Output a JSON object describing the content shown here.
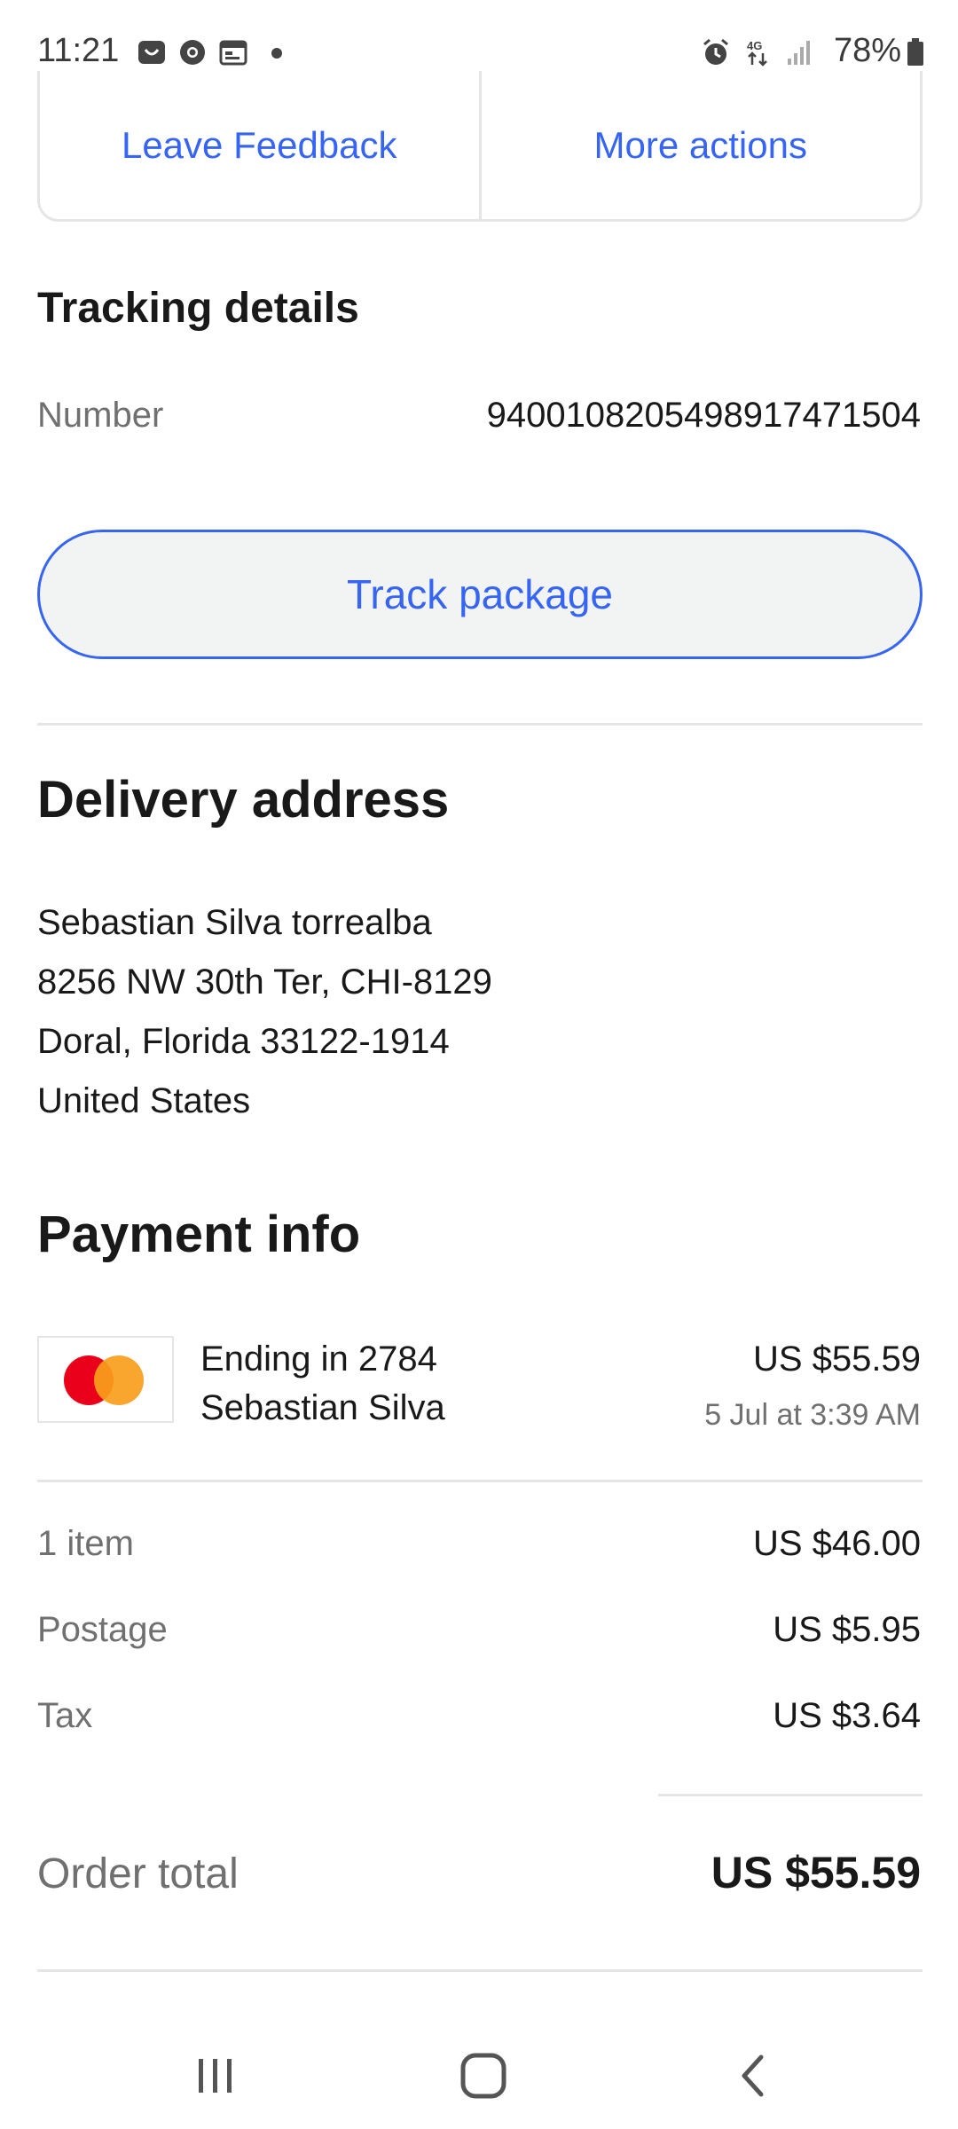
{
  "status_bar": {
    "time": "11:21",
    "battery": "78%",
    "icons": [
      "ebay-app-icon",
      "chrome-icon",
      "calendar-icon",
      "alarm-icon",
      "4g-icon",
      "signal-icon",
      "battery-icon"
    ]
  },
  "actions": {
    "leave_feedback": "Leave Feedback",
    "more_actions": "More actions"
  },
  "tracking": {
    "title": "Tracking details",
    "number_label": "Number",
    "number_value": "9400108205498917471504",
    "track_button": "Track package"
  },
  "delivery": {
    "title": "Delivery address",
    "lines": [
      "Sebastian Silva torrealba",
      "8256 NW 30th Ter, CHI-8129",
      "Doral, Florida 33122-1914",
      "United States"
    ]
  },
  "payment": {
    "title": "Payment info",
    "card_ending": "Ending in 2784",
    "card_holder": "Sebastian Silva",
    "amount": "US $55.59",
    "date": "5 Jul at 3:39 AM"
  },
  "summary": {
    "rows": [
      {
        "label": "1 item",
        "value": "US $46.00"
      },
      {
        "label": "Postage",
        "value": "US $5.95"
      },
      {
        "label": "Tax",
        "value": "US $3.64"
      }
    ],
    "total_label": "Order total",
    "total_value": "US $55.59"
  },
  "colors": {
    "accent": "#3665f3",
    "mastercard_red": "#eb001b",
    "mastercard_orange": "#f79e1b"
  }
}
